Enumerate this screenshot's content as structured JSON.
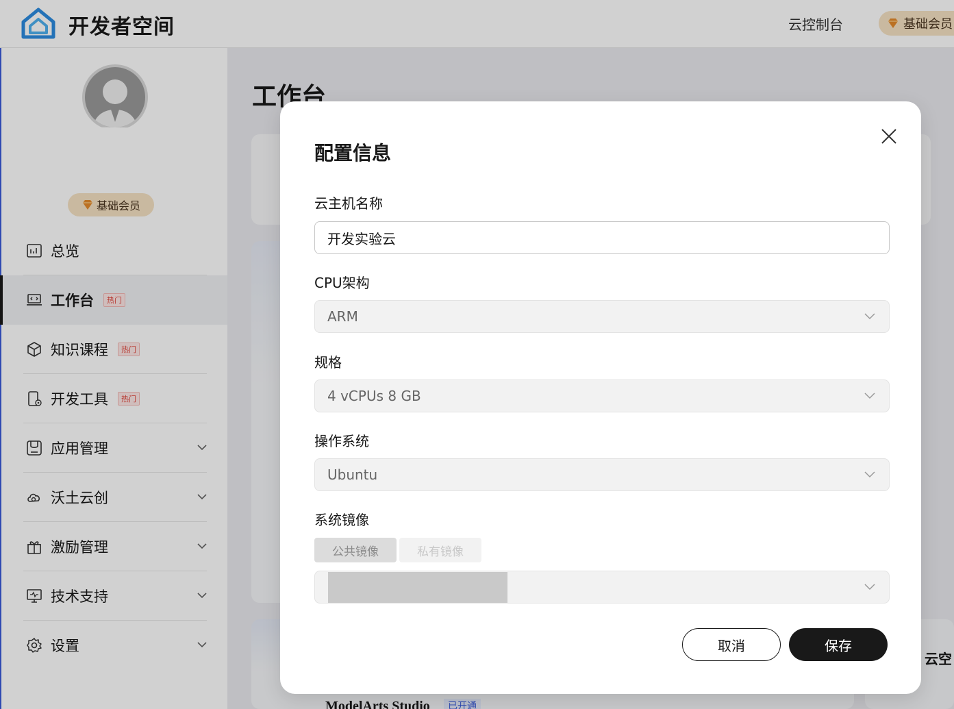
{
  "app": {
    "title": "开发者空间"
  },
  "header": {
    "console_link": "云控制台",
    "member_badge": "基础会员"
  },
  "sidebar": {
    "member_badge": "基础会员",
    "items": [
      {
        "label": "总览",
        "icon": "chart-icon",
        "hot": "",
        "expandable": false
      },
      {
        "label": "工作台",
        "icon": "laptop-code-icon",
        "hot": "热门",
        "expandable": false,
        "active": true
      },
      {
        "label": "知识课程",
        "icon": "cube-icon",
        "hot": "热门",
        "expandable": false
      },
      {
        "label": "开发工具",
        "icon": "phone-gear-icon",
        "hot": "热门",
        "expandable": false
      },
      {
        "label": "应用管理",
        "icon": "app-box-icon",
        "hot": "",
        "expandable": true
      },
      {
        "label": "沃土云创",
        "icon": "cloud-icon",
        "hot": "",
        "expandable": true
      },
      {
        "label": "激励管理",
        "icon": "gift-icon",
        "hot": "",
        "expandable": true
      },
      {
        "label": "技术支持",
        "icon": "monitor-icon",
        "hot": "",
        "expandable": true
      },
      {
        "label": "设置",
        "icon": "gear-icon",
        "hot": "",
        "expandable": true
      }
    ]
  },
  "main": {
    "title": "工作台",
    "bg_heading_right": "云空",
    "bg_app_name": "ModelArts Studio",
    "bg_app_tag": "已开通"
  },
  "modal": {
    "title": "配置信息",
    "fields": {
      "name": {
        "label": "云主机名称",
        "value": "开发实验云"
      },
      "cpu": {
        "label": "CPU架构",
        "value": "ARM"
      },
      "spec": {
        "label": "规格",
        "value": "4 vCPUs 8 GB"
      },
      "os": {
        "label": "操作系统",
        "value": "Ubuntu"
      },
      "image": {
        "label": "系统镜像",
        "tab_public": "公共镜像",
        "tab_private": "私有镜像"
      }
    },
    "buttons": {
      "cancel": "取消",
      "save": "保存"
    }
  },
  "colors": {
    "accent_dark": "#191919",
    "member_gold": "#f6e2c4",
    "hot_red": "#e0473e"
  }
}
